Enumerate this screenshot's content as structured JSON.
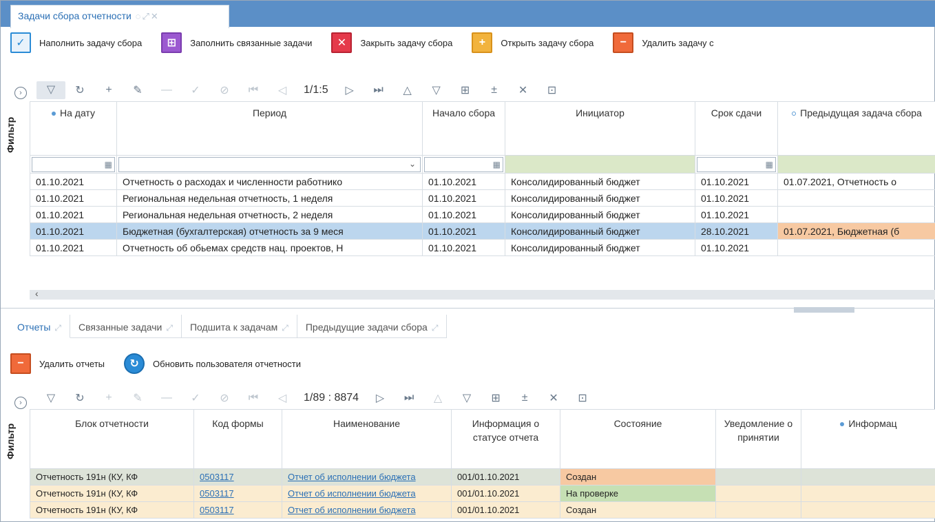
{
  "window_tab": {
    "title": "Задачи сбора отчетности",
    "icons": [
      "refresh-icon",
      "expand-icon",
      "close-icon"
    ]
  },
  "top_actions": [
    {
      "label": "Наполнить задачу сбора",
      "icon": "fill-task-icon"
    },
    {
      "label": "Заполнить связанные задачи",
      "icon": "related-tasks-icon"
    },
    {
      "label": "Закрыть задачу сбора",
      "icon": "close-task-icon"
    },
    {
      "label": "Открыть задачу сбора",
      "icon": "open-task-icon"
    },
    {
      "label": "Удалить задачу с",
      "icon": "delete-task-icon"
    }
  ],
  "grid1_pager": "1/1:5",
  "filter_label": "Фильтр",
  "grid1": {
    "headers": [
      "На дату",
      "Период",
      "Начало сбора",
      "Инициатор",
      "Срок сдачи",
      "Предыдущая задача сбора"
    ],
    "rows": [
      [
        "01.10.2021",
        "Отчетность о расходах и численности работнико",
        "01.10.2021",
        "Консолидированный бюджет",
        "01.10.2021",
        "01.07.2021, Отчетность о"
      ],
      [
        "01.10.2021",
        "Региональная недельная отчетность, 1 неделя",
        "01.10.2021",
        "Консолидированный бюджет",
        "01.10.2021",
        ""
      ],
      [
        "01.10.2021",
        "Региональная недельная отчетность, 2 неделя",
        "01.10.2021",
        "Консолидированный бюджет",
        "01.10.2021",
        ""
      ],
      [
        "01.10.2021",
        "Бюджетная (бухгалтерская) отчетность за 9 меся",
        "01.10.2021",
        "Консолидированный бюджет",
        "28.10.2021",
        "01.07.2021, Бюджетная (б"
      ],
      [
        "01.10.2021",
        "Отчетность об обьемах средств нац. проектов, Н",
        "01.10.2021",
        "Консолидированный бюджет",
        "01.10.2021",
        ""
      ]
    ]
  },
  "tabs": [
    "Отчеты",
    "Связанные задачи",
    "Подшита к задачам",
    "Предыдущие задачи сбора"
  ],
  "bottom_actions": [
    {
      "label": "Удалить отчеты",
      "icon": "delete-reports-icon"
    },
    {
      "label": "Обновить пользователя отчетности",
      "icon": "refresh-user-icon"
    }
  ],
  "grid2_pager": "1/89 : 8874",
  "grid2": {
    "headers": [
      "Блок отчетности",
      "Код формы",
      "Наименование",
      "Информация о статусе отчета",
      "Состояние",
      "Уведомление о принятии",
      "Информац"
    ],
    "rows": [
      [
        "Отчетность 191н (КУ, КФ",
        "0503117",
        "Отчет об исполнении бюджета",
        "001/01.10.2021",
        "Создан",
        "",
        ""
      ],
      [
        "Отчетность 191н (КУ, КФ",
        "0503117",
        "Отчет об исполнении бюджета",
        "001/01.10.2021",
        "На проверке",
        "",
        ""
      ],
      [
        "Отчетность 191н (КУ, КФ",
        "0503117",
        "Отчет об исполнении бюджета",
        "001/01.10.2021",
        "Создан",
        "",
        ""
      ]
    ]
  }
}
